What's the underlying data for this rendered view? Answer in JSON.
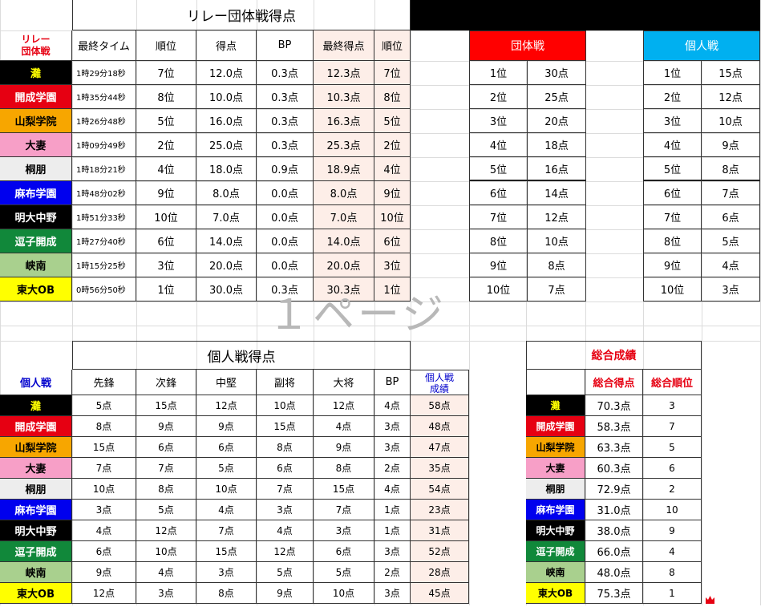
{
  "relay": {
    "title": "リレー団体戦得点",
    "corner_line1": "リレー",
    "corner_line2": "団体戦",
    "headers": [
      "最終タイム",
      "順位",
      "得点",
      "BP",
      "最終得点",
      "順位"
    ],
    "rows": [
      {
        "team": "灘",
        "time": "1時29分18秒",
        "rank": "7位",
        "points": "12.0点",
        "bp": "0.3点",
        "final": "12.3点",
        "final_rank": "7位"
      },
      {
        "team": "開成学園",
        "time": "1時35分44秒",
        "rank": "8位",
        "points": "10.0点",
        "bp": "0.3点",
        "final": "10.3点",
        "final_rank": "8位"
      },
      {
        "team": "山梨学院",
        "time": "1時26分48秒",
        "rank": "5位",
        "points": "16.0点",
        "bp": "0.3点",
        "final": "16.3点",
        "final_rank": "5位"
      },
      {
        "team": "大妻",
        "time": "1時09分49秒",
        "rank": "2位",
        "points": "25.0点",
        "bp": "0.3点",
        "final": "25.3点",
        "final_rank": "2位"
      },
      {
        "team": "桐朋",
        "time": "1時18分21秒",
        "rank": "4位",
        "points": "18.0点",
        "bp": "0.9点",
        "final": "18.9点",
        "final_rank": "4位"
      },
      {
        "team": "麻布学園",
        "time": "1時48分02秒",
        "rank": "9位",
        "points": "8.0点",
        "bp": "0.0点",
        "final": "8.0点",
        "final_rank": "9位"
      },
      {
        "team": "明大中野",
        "time": "1時51分33秒",
        "rank": "10位",
        "points": "7.0点",
        "bp": "0.0点",
        "final": "7.0点",
        "final_rank": "10位"
      },
      {
        "team": "逗子開成",
        "time": "1時27分40秒",
        "rank": "6位",
        "points": "14.0点",
        "bp": "0.0点",
        "final": "14.0点",
        "final_rank": "6位"
      },
      {
        "team": "峡南",
        "time": "1時15分25秒",
        "rank": "3位",
        "points": "20.0点",
        "bp": "0.0点",
        "final": "20.0点",
        "final_rank": "3位"
      },
      {
        "team": "東大OB",
        "time": "0時56分50秒",
        "rank": "1位",
        "points": "30.0点",
        "bp": "0.3点",
        "final": "30.3点",
        "final_rank": "1位"
      }
    ]
  },
  "team_colors": [
    {
      "bg": "#000000",
      "fg": "#ffff00"
    },
    {
      "bg": "#e60012",
      "fg": "#ffffff"
    },
    {
      "bg": "#f7a600",
      "fg": "#000000"
    },
    {
      "bg": "#f79fc7",
      "fg": "#000000"
    },
    {
      "bg": "#ededed",
      "fg": "#000000"
    },
    {
      "bg": "#0000ee",
      "fg": "#ffffff"
    },
    {
      "bg": "#000000",
      "fg": "#ffffff"
    },
    {
      "bg": "#11883a",
      "fg": "#ffffff"
    },
    {
      "bg": "#a9d08e",
      "fg": "#000000"
    },
    {
      "bg": "#ffff00",
      "fg": "#000000"
    }
  ],
  "team_points_table": {
    "title": "団体戦",
    "title_bg": "#ff0000",
    "rows": [
      {
        "rank": "1位",
        "points": "30点"
      },
      {
        "rank": "2位",
        "points": "25点"
      },
      {
        "rank": "3位",
        "points": "20点"
      },
      {
        "rank": "4位",
        "points": "18点"
      },
      {
        "rank": "5位",
        "points": "16点"
      },
      {
        "rank": "6位",
        "points": "14点"
      },
      {
        "rank": "7位",
        "points": "12点"
      },
      {
        "rank": "8位",
        "points": "10点"
      },
      {
        "rank": "9位",
        "points": "8点"
      },
      {
        "rank": "10位",
        "points": "7点"
      }
    ]
  },
  "individual_points_table": {
    "title": "個人戦",
    "title_bg": "#00b0f0",
    "rows": [
      {
        "rank": "1位",
        "points": "15点"
      },
      {
        "rank": "2位",
        "points": "12点"
      },
      {
        "rank": "3位",
        "points": "10点"
      },
      {
        "rank": "4位",
        "points": "9点"
      },
      {
        "rank": "5位",
        "points": "8点"
      },
      {
        "rank": "6位",
        "points": "7点"
      },
      {
        "rank": "7位",
        "points": "6点"
      },
      {
        "rank": "8位",
        "points": "5点"
      },
      {
        "rank": "9位",
        "points": "4点"
      },
      {
        "rank": "10位",
        "points": "3点"
      }
    ]
  },
  "watermark": "１ページ",
  "individual": {
    "title": "個人戦得点",
    "corner": "個人戦",
    "headers": [
      "先鋒",
      "次鋒",
      "中堅",
      "副将",
      "大将",
      "BP"
    ],
    "result_header_line1": "個人戦",
    "result_header_line2": "成績",
    "rows": [
      {
        "team": "灘",
        "scores": [
          "5点",
          "15点",
          "12点",
          "10点",
          "12点",
          "4点"
        ],
        "total": "58点"
      },
      {
        "team": "開成学園",
        "scores": [
          "8点",
          "9点",
          "9点",
          "15点",
          "4点",
          "3点"
        ],
        "total": "48点"
      },
      {
        "team": "山梨学院",
        "scores": [
          "15点",
          "6点",
          "6点",
          "8点",
          "9点",
          "3点"
        ],
        "total": "47点"
      },
      {
        "team": "大妻",
        "scores": [
          "7点",
          "7点",
          "5点",
          "6点",
          "8点",
          "2点"
        ],
        "total": "35点"
      },
      {
        "team": "桐朋",
        "scores": [
          "10点",
          "8点",
          "10点",
          "7点",
          "15点",
          "4点"
        ],
        "total": "54点"
      },
      {
        "team": "麻布学園",
        "scores": [
          "3点",
          "5点",
          "4点",
          "3点",
          "7点",
          "1点"
        ],
        "total": "23点"
      },
      {
        "team": "明大中野",
        "scores": [
          "4点",
          "12点",
          "7点",
          "4点",
          "3点",
          "1点"
        ],
        "total": "31点"
      },
      {
        "team": "逗子開成",
        "scores": [
          "6点",
          "10点",
          "15点",
          "12点",
          "6点",
          "3点"
        ],
        "total": "52点"
      },
      {
        "team": "峡南",
        "scores": [
          "9点",
          "4点",
          "3点",
          "5点",
          "5点",
          "2点"
        ],
        "total": "28点"
      },
      {
        "team": "東大OB",
        "scores": [
          "12点",
          "3点",
          "8点",
          "9点",
          "10点",
          "3点"
        ],
        "total": "45点"
      }
    ]
  },
  "overall": {
    "title": "総合成績",
    "headers": [
      "総合得点",
      "総合順位"
    ],
    "rows": [
      {
        "team": "灘",
        "score": "70.3点",
        "rank": "3"
      },
      {
        "team": "開成学園",
        "score": "58.3点",
        "rank": "7"
      },
      {
        "team": "山梨学院",
        "score": "63.3点",
        "rank": "5"
      },
      {
        "team": "大妻",
        "score": "60.3点",
        "rank": "6"
      },
      {
        "team": "桐朋",
        "score": "72.9点",
        "rank": "2"
      },
      {
        "team": "麻布学園",
        "score": "31.0点",
        "rank": "10"
      },
      {
        "team": "明大中野",
        "score": "38.0点",
        "rank": "9"
      },
      {
        "team": "逗子開成",
        "score": "66.0点",
        "rank": "4"
      },
      {
        "team": "峡南",
        "score": "48.0点",
        "rank": "8"
      },
      {
        "team": "東大OB",
        "score": "75.3点",
        "rank": "1"
      }
    ]
  },
  "crown_icon": "crown-icon"
}
